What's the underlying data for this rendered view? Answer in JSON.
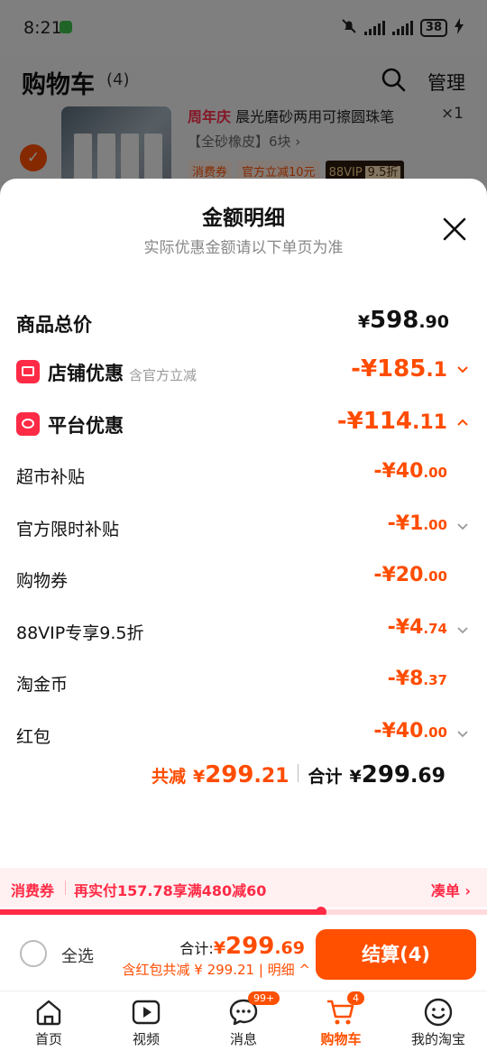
{
  "status_bar": {
    "time": "8:21",
    "battery": "38"
  },
  "cart": {
    "title": "购物车",
    "count": "(4)",
    "manage": "管理",
    "item": {
      "brand_tag": "周年庆",
      "title": "晨光磨砂两用可擦圆珠笔",
      "spec": "【全砂橡皮】6块 ›",
      "qty": "×1",
      "tags": [
        "消费券",
        "官方立减10元"
      ],
      "vip_tag": "88VIP",
      "vip_discount": "9.5折"
    }
  },
  "sheet": {
    "title": "金额明细",
    "subtitle": "实际优惠金额请以下单页为准",
    "total": {
      "label": "商品总价",
      "currency": "¥",
      "int": "598",
      "dec": ".90"
    },
    "store_discount": {
      "label": "店铺优惠",
      "note": "含官方立减",
      "int": "-¥185",
      "dec": ".1"
    },
    "platform_discount": {
      "label": "平台优惠",
      "int": "-¥114",
      "dec": ".11"
    },
    "details": [
      {
        "label": "超市补贴",
        "int": "-¥40",
        "dec": ".00",
        "chevron": false
      },
      {
        "label": "官方限时补贴",
        "int": "-¥1",
        "dec": ".00",
        "chevron": true
      },
      {
        "label": "购物券",
        "int": "-¥20",
        "dec": ".00",
        "chevron": false
      },
      {
        "label": "88VIP专享9.5折",
        "int": "-¥4",
        "dec": ".74",
        "chevron": true
      },
      {
        "label": "淘金币",
        "int": "-¥8",
        "dec": ".37",
        "chevron": false
      },
      {
        "label": "红包",
        "int": "-¥40",
        "dec": ".00",
        "chevron": true
      }
    ],
    "summary": {
      "saved_label": "共减",
      "saved_cur": "¥",
      "saved_int": "299",
      "saved_dec": ".21",
      "total_label": "合计",
      "total_cur": "¥",
      "total_int": "299",
      "total_dec": ".69"
    }
  },
  "promo": {
    "tag": "消费券",
    "text": "再实付157.78享满480减60",
    "action": "凑单 ›",
    "progress": 0.66
  },
  "checkout": {
    "select_all": "全选",
    "sum_label": "合计:",
    "sum_cur": "¥",
    "sum_int": "299",
    "sum_dec": ".69",
    "sub": "含红包共减 ¥ 299.21 | 明细 ^",
    "pay_button": "结算(4)"
  },
  "tabbar": [
    {
      "label": "首页",
      "icon": "home-icon"
    },
    {
      "label": "视频",
      "icon": "video-icon"
    },
    {
      "label": "消息",
      "icon": "message-icon",
      "badge": "99+"
    },
    {
      "label": "购物车",
      "icon": "cart-icon",
      "badge": "4",
      "active": true
    },
    {
      "label": "我的淘宝",
      "icon": "profile-icon"
    }
  ],
  "colors": {
    "accent": "#ff5000",
    "price": "#ff4c00",
    "badge_red": "#ff2a45"
  }
}
